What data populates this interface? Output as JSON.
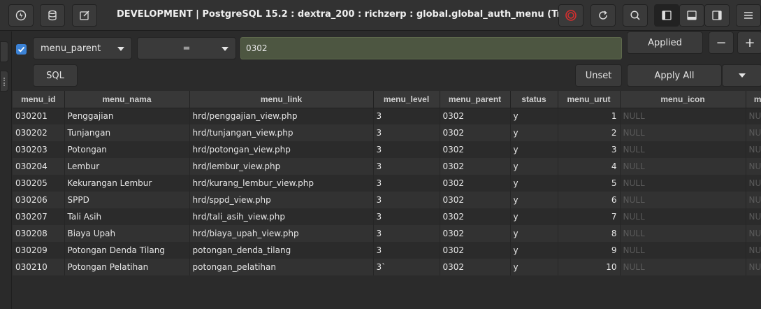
{
  "window": {
    "title": "DEVELOPMENT | PostgreSQL 15.2 : dextra_200 : richzerp : global.global_auth_menu (Trial)"
  },
  "toolbar": {
    "icons": [
      "connection-icon",
      "database-icon",
      "edit-icon",
      "stop-icon",
      "refresh-icon",
      "search-icon",
      "sidebar-left-icon",
      "panel-bottom-icon",
      "sidebar-right-icon",
      "menu-icon"
    ],
    "stop_color": "#d32f2f"
  },
  "filter": {
    "checked": true,
    "column": "menu_parent",
    "operator": "=",
    "value": "0302",
    "applied_label": "Applied",
    "minus_label": "−",
    "plus_label": "+",
    "sql_label": "SQL",
    "unset_label": "Unset",
    "apply_all_label": "Apply All"
  },
  "table": {
    "columns": [
      "menu_id",
      "menu_nama",
      "menu_link",
      "menu_level",
      "menu_parent",
      "status",
      "menu_urut",
      "menu_icon",
      "me"
    ],
    "rows": [
      [
        "030201",
        "Penggajian",
        "hrd/penggajian_view.php",
        "3",
        "0302",
        "y",
        "1",
        "NULL",
        "NUL"
      ],
      [
        "030202",
        "Tunjangan",
        "hrd/tunjangan_view.php",
        "3",
        "0302",
        "y",
        "2",
        "NULL",
        "NUL"
      ],
      [
        "030203",
        "Potongan",
        "hrd/potongan_view.php",
        "3",
        "0302",
        "y",
        "3",
        "NULL",
        "NUL"
      ],
      [
        "030204",
        "Lembur",
        "hrd/lembur_view.php",
        "3",
        "0302",
        "y",
        "4",
        "NULL",
        "NUL"
      ],
      [
        "030205",
        "Kekurangan Lembur",
        "hrd/kurang_lembur_view.php",
        "3",
        "0302",
        "y",
        "5",
        "NULL",
        "NUL"
      ],
      [
        "030206",
        "SPPD",
        "hrd/sppd_view.php",
        "3",
        "0302",
        "y",
        "6",
        "NULL",
        "NUL"
      ],
      [
        "030207",
        "Tali Asih",
        "hrd/tali_asih_view.php",
        "3",
        "0302",
        "y",
        "7",
        "NULL",
        "NUL"
      ],
      [
        "030208",
        "Biaya Upah",
        "hrd/biaya_upah_view.php",
        "3",
        "0302",
        "y",
        "8",
        "NULL",
        "NUL"
      ],
      [
        "030209",
        "Potongan Denda Tilang",
        "potongan_denda_tilang",
        "3",
        "0302",
        "y",
        "9",
        "NULL",
        "NUL"
      ],
      [
        "030210",
        "Potongan Pelatihan",
        "potongan_pelatihan",
        "3`",
        "0302",
        "y",
        "10",
        "NULL",
        "NUL"
      ]
    ]
  }
}
